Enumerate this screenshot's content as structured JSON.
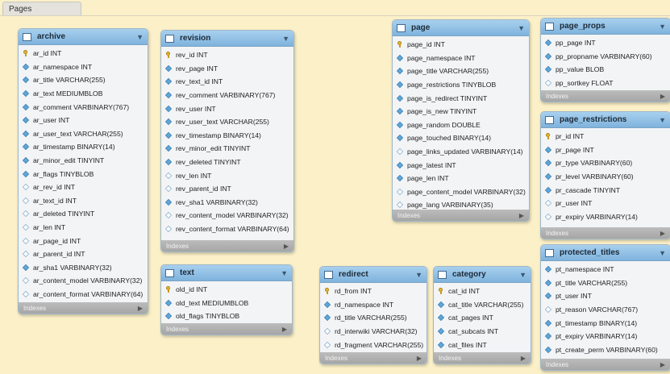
{
  "page_tab": "Pages",
  "indexes_label": "Indexes",
  "tables": {
    "archive": {
      "name": "archive",
      "columns": [
        {
          "name": "ar_id INT",
          "icon": "key"
        },
        {
          "name": "ar_namespace INT",
          "icon": "column"
        },
        {
          "name": "ar_title VARCHAR(255)",
          "icon": "column"
        },
        {
          "name": "ar_text MEDIUMBLOB",
          "icon": "column"
        },
        {
          "name": "ar_comment VARBINARY(767)",
          "icon": "column"
        },
        {
          "name": "ar_user INT",
          "icon": "column"
        },
        {
          "name": "ar_user_text VARCHAR(255)",
          "icon": "column"
        },
        {
          "name": "ar_timestamp BINARY(14)",
          "icon": "column"
        },
        {
          "name": "ar_minor_edit TINYINT",
          "icon": "column"
        },
        {
          "name": "ar_flags TINYBLOB",
          "icon": "column"
        },
        {
          "name": "ar_rev_id INT",
          "icon": "nullable"
        },
        {
          "name": "ar_text_id INT",
          "icon": "nullable"
        },
        {
          "name": "ar_deleted TINYINT",
          "icon": "nullable"
        },
        {
          "name": "ar_len INT",
          "icon": "nullable"
        },
        {
          "name": "ar_page_id INT",
          "icon": "nullable"
        },
        {
          "name": "ar_parent_id INT",
          "icon": "nullable"
        },
        {
          "name": "ar_sha1 VARBINARY(32)",
          "icon": "column"
        },
        {
          "name": "ar_content_model VARBINARY(32)",
          "icon": "nullable"
        },
        {
          "name": "ar_content_format VARBINARY(64)",
          "icon": "nullable"
        }
      ]
    },
    "revision": {
      "name": "revision",
      "columns": [
        {
          "name": "rev_id INT",
          "icon": "key"
        },
        {
          "name": "rev_page INT",
          "icon": "column"
        },
        {
          "name": "rev_text_id INT",
          "icon": "column"
        },
        {
          "name": "rev_comment VARBINARY(767)",
          "icon": "column"
        },
        {
          "name": "rev_user INT",
          "icon": "column"
        },
        {
          "name": "rev_user_text VARCHAR(255)",
          "icon": "column"
        },
        {
          "name": "rev_timestamp BINARY(14)",
          "icon": "column"
        },
        {
          "name": "rev_minor_edit TINYINT",
          "icon": "column"
        },
        {
          "name": "rev_deleted TINYINT",
          "icon": "column"
        },
        {
          "name": "rev_len INT",
          "icon": "nullable"
        },
        {
          "name": "rev_parent_id INT",
          "icon": "nullable"
        },
        {
          "name": "rev_sha1 VARBINARY(32)",
          "icon": "column"
        },
        {
          "name": "rev_content_model VARBINARY(32)",
          "icon": "nullable"
        },
        {
          "name": "rev_content_format VARBINARY(64)",
          "icon": "nullable"
        }
      ]
    },
    "text": {
      "name": "text",
      "columns": [
        {
          "name": "old_id INT",
          "icon": "key"
        },
        {
          "name": "old_text MEDIUMBLOB",
          "icon": "column"
        },
        {
          "name": "old_flags TINYBLOB",
          "icon": "column"
        }
      ]
    },
    "redirect": {
      "name": "redirect",
      "columns": [
        {
          "name": "rd_from INT",
          "icon": "key"
        },
        {
          "name": "rd_namespace INT",
          "icon": "column"
        },
        {
          "name": "rd_title VARCHAR(255)",
          "icon": "column"
        },
        {
          "name": "rd_interwiki VARCHAR(32)",
          "icon": "nullable"
        },
        {
          "name": "rd_fragment VARCHAR(255)",
          "icon": "nullable"
        }
      ]
    },
    "category": {
      "name": "category",
      "columns": [
        {
          "name": "cat_id INT",
          "icon": "key"
        },
        {
          "name": "cat_title VARCHAR(255)",
          "icon": "column"
        },
        {
          "name": "cat_pages INT",
          "icon": "column"
        },
        {
          "name": "cat_subcats INT",
          "icon": "column"
        },
        {
          "name": "cat_files INT",
          "icon": "column"
        }
      ]
    },
    "page": {
      "name": "page",
      "columns": [
        {
          "name": "page_id INT",
          "icon": "key"
        },
        {
          "name": "page_namespace INT",
          "icon": "column"
        },
        {
          "name": "page_title VARCHAR(255)",
          "icon": "column"
        },
        {
          "name": "page_restrictions TINYBLOB",
          "icon": "column"
        },
        {
          "name": "page_is_redirect TINYINT",
          "icon": "column"
        },
        {
          "name": "page_is_new TINYINT",
          "icon": "column"
        },
        {
          "name": "page_random DOUBLE",
          "icon": "column"
        },
        {
          "name": "page_touched BINARY(14)",
          "icon": "column"
        },
        {
          "name": "page_links_updated VARBINARY(14)",
          "icon": "nullable"
        },
        {
          "name": "page_latest INT",
          "icon": "column"
        },
        {
          "name": "page_len INT",
          "icon": "column"
        },
        {
          "name": "page_content_model VARBINARY(32)",
          "icon": "nullable"
        },
        {
          "name": "page_lang VARBINARY(35)",
          "icon": "nullable"
        }
      ]
    },
    "page_props": {
      "name": "page_props",
      "columns": [
        {
          "name": "pp_page INT",
          "icon": "column"
        },
        {
          "name": "pp_propname VARBINARY(60)",
          "icon": "column"
        },
        {
          "name": "pp_value BLOB",
          "icon": "column"
        },
        {
          "name": "pp_sortkey FLOAT",
          "icon": "nullable"
        }
      ]
    },
    "page_restrictions": {
      "name": "page_restrictions",
      "columns": [
        {
          "name": "pr_id INT",
          "icon": "key"
        },
        {
          "name": "pr_page INT",
          "icon": "column"
        },
        {
          "name": "pr_type VARBINARY(60)",
          "icon": "column"
        },
        {
          "name": "pr_level VARBINARY(60)",
          "icon": "column"
        },
        {
          "name": "pr_cascade TINYINT",
          "icon": "column"
        },
        {
          "name": "pr_user INT",
          "icon": "nullable"
        },
        {
          "name": "pr_expiry VARBINARY(14)",
          "icon": "nullable"
        }
      ]
    },
    "protected_titles": {
      "name": "protected_titles",
      "columns": [
        {
          "name": "pt_namespace INT",
          "icon": "column"
        },
        {
          "name": "pt_title VARCHAR(255)",
          "icon": "column"
        },
        {
          "name": "pt_user INT",
          "icon": "column"
        },
        {
          "name": "pt_reason VARCHAR(767)",
          "icon": "nullable"
        },
        {
          "name": "pt_timestamp BINARY(14)",
          "icon": "column"
        },
        {
          "name": "pt_expiry VARBINARY(14)",
          "icon": "column"
        },
        {
          "name": "pt_create_perm VARBINARY(60)",
          "icon": "column"
        }
      ]
    }
  }
}
